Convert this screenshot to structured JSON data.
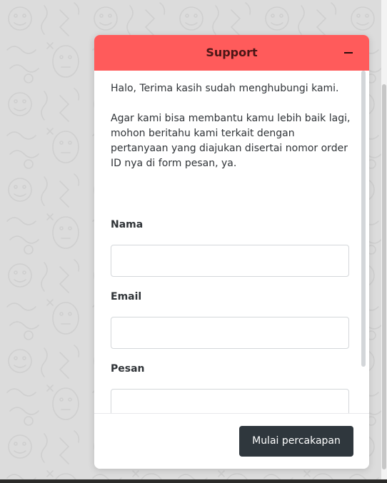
{
  "widget": {
    "title": "Support",
    "header_color": "#ff5b5b",
    "intro": {
      "greeting": "Halo, Terima kasih sudah menghubungi kami.",
      "instructions": "Agar kami bisa membantu kamu lebih baik lagi, mohon beritahu kami terkait dengan pertanyaan yang diajukan disertai nomor order ID nya di form pesan, ya."
    },
    "form": {
      "name_label": "Nama",
      "name_value": "",
      "email_label": "Email",
      "email_value": "",
      "message_label": "Pesan",
      "message_value": ""
    },
    "submit_label": "Mulai percakapan",
    "submit_color": "#2f373d"
  }
}
